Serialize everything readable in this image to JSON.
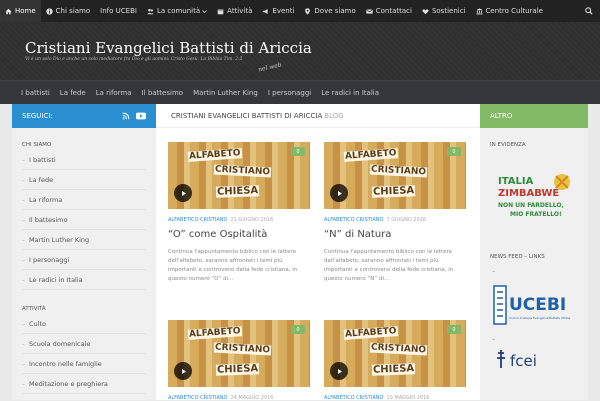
{
  "topnav": {
    "items": [
      {
        "label": "Home",
        "icon": "home-icon",
        "active": true
      },
      {
        "label": "Chi siamo",
        "icon": "info-icon"
      },
      {
        "label": "Info UCEBI",
        "icon": ""
      },
      {
        "label": "La comunità",
        "icon": "users-icon",
        "dropdown": true
      },
      {
        "label": "Attività",
        "icon": "calendar-icon"
      },
      {
        "label": "Eventi",
        "icon": "bullhorn-icon"
      },
      {
        "label": "Dove siamo",
        "icon": "map-marker-icon"
      },
      {
        "label": "Contattaci",
        "icon": "envelope-icon"
      },
      {
        "label": "Sostienici",
        "icon": "heart-icon"
      },
      {
        "label": "Centro Culturale",
        "icon": "university-icon"
      }
    ]
  },
  "header": {
    "title": "Cristiani Evangelici Battisti di Ariccia",
    "tagline": "Vi è un solo Dio e anche un solo mediatore fra Dio e gli uomini: Cristo Gesù. La Bibbia Tim. 2:5",
    "nel_web": "nel web"
  },
  "mainnav": {
    "items": [
      "I battisti",
      "La fede",
      "La riforma",
      "Il battesimo",
      "Martin Luther King",
      "I personaggi",
      "Le radici in Italia"
    ]
  },
  "left": {
    "follow_label": "SEGUICI:",
    "widget1_title": "CHI SIAMO",
    "widget1_items": [
      "I battisti",
      "La fede",
      "La riforma",
      "Il battesimo",
      "Martin Luther King",
      "I personaggi",
      "Le radici in Italia"
    ],
    "widget2_title": "ATTIVITÀ",
    "widget2_items": [
      "Culto",
      "Scuola domenicale",
      "Incontro nelle famiglie",
      "Meditazione e preghiera"
    ]
  },
  "main": {
    "heading": "CRISTIANI EVANGELICI BATTISTI DI ARICCIA",
    "heading_suffix": "BLOG",
    "posts": [
      {
        "category": "ALFABETICO CRISTIANO",
        "date": "21 GIUGNO 2016",
        "title": "“O” come Ospitalità",
        "excerpt": "Continua l'appuntamento biblico con le lettere dell'alfabeto, saranno affrontati i temi più importanti e controversi della fede cristiana, in questo numero “O” di...",
        "comments": "0"
      },
      {
        "category": "ALFABETICO CRISTIANO",
        "date": "7 GIUGNO 2016",
        "title": "“N” di Natura",
        "excerpt": "Continua l'appuntamento biblico con le lettere dell'alfabeto, saranno affrontati i temi più importanti e controversi della fede cristiana, in questo numero “N” di...",
        "comments": "0"
      },
      {
        "category": "ALFABETICO CRISTIANO",
        "date": "24 MAGGIO 2016",
        "title": "",
        "excerpt": "",
        "comments": "0"
      },
      {
        "category": "ALFABETICO CRISTIANO",
        "date": "10 MAGGIO 2016",
        "title": "",
        "excerpt": "",
        "comments": "0"
      }
    ],
    "thumb_words": [
      "ALFABETO",
      "CRISTIANO",
      "CHIESA"
    ]
  },
  "right": {
    "header": "ALTRO",
    "evidenza_title": "IN EVIDENZA",
    "zim_line1": "ITALIA",
    "zim_line2": "ZIMBABWE",
    "zim_line3": "NON UN FARDELLO,",
    "zim_line4": "MIO FRATELLO!",
    "news_title": "NEWS FEED – LINKS",
    "dash": "–",
    "ucebi_name": "UCEBI",
    "ucebi_sub": "Unione Cristiana Evangelica Battista d'Italia",
    "fcei_name": "fcei"
  },
  "colors": {
    "topbar": "#222222",
    "header": "#2f2f2f",
    "mainnav": "#33363b",
    "accent_blue": "#2a8fd1",
    "accent_green": "#82b965"
  }
}
